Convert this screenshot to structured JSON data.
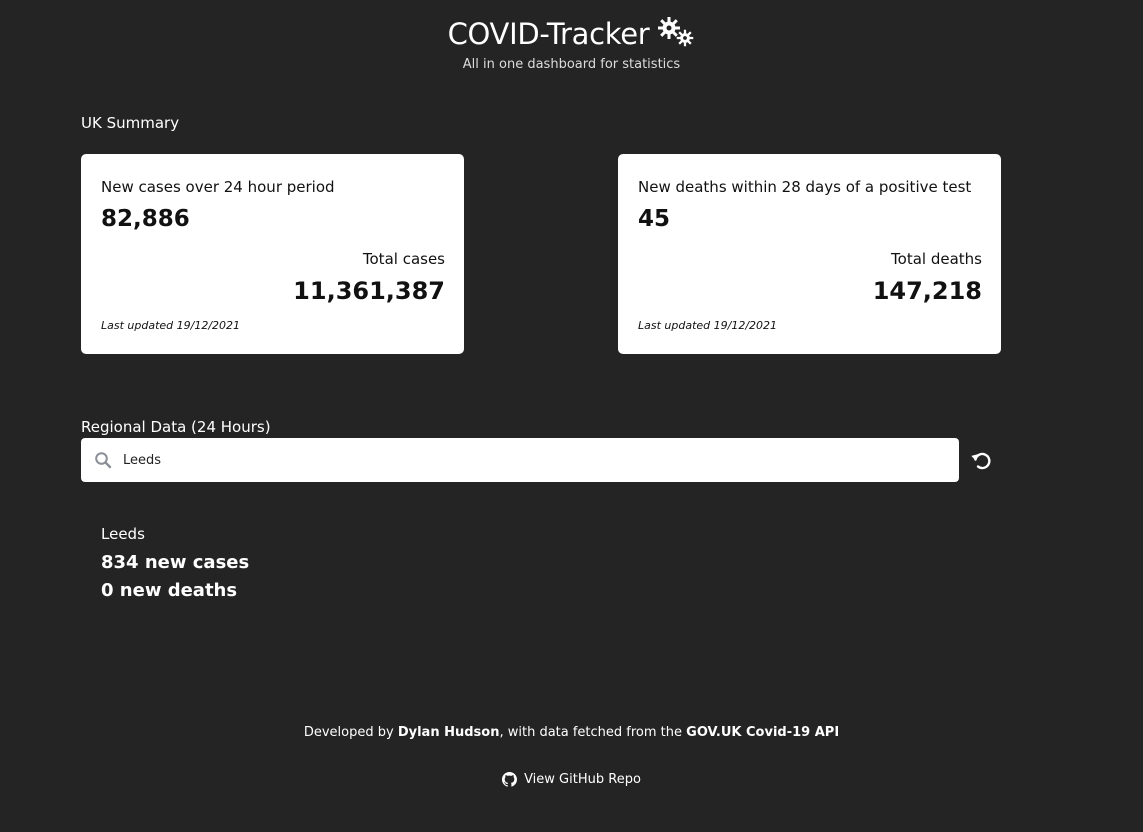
{
  "header": {
    "title": "COVID-Tracker",
    "subtitle": "All in one dashboard for statistics",
    "title_icon": "gears-icon"
  },
  "uk_summary": {
    "label": "UK Summary",
    "cases_card": {
      "heading": "New cases over 24 hour period",
      "value": "82,886",
      "total_label": "Total cases",
      "total_value": "11,361,387",
      "updated": "Last updated 19/12/2021"
    },
    "deaths_card": {
      "heading": "New deaths within 28 days of a positive test",
      "value": "45",
      "total_label": "Total deaths",
      "total_value": "147,218",
      "updated": "Last updated 19/12/2021"
    }
  },
  "regional": {
    "label": "Regional Data (24 Hours)",
    "search_value": "Leeds",
    "search_icon": "search-icon",
    "reset_icon": "reset-icon",
    "result": {
      "place": "Leeds",
      "cases": "834 new cases",
      "deaths": "0 new deaths"
    }
  },
  "footer": {
    "prefix": "Developed by ",
    "author": "Dylan Hudson",
    "middle": ", with data fetched from the ",
    "source": "GOV.UK Covid-19 API",
    "repo_label": "View GitHub Repo",
    "repo_icon": "github-icon"
  },
  "colors": {
    "background": "#242424",
    "card": "#ffffff",
    "text": "#ffffff",
    "card_text": "#111111"
  }
}
